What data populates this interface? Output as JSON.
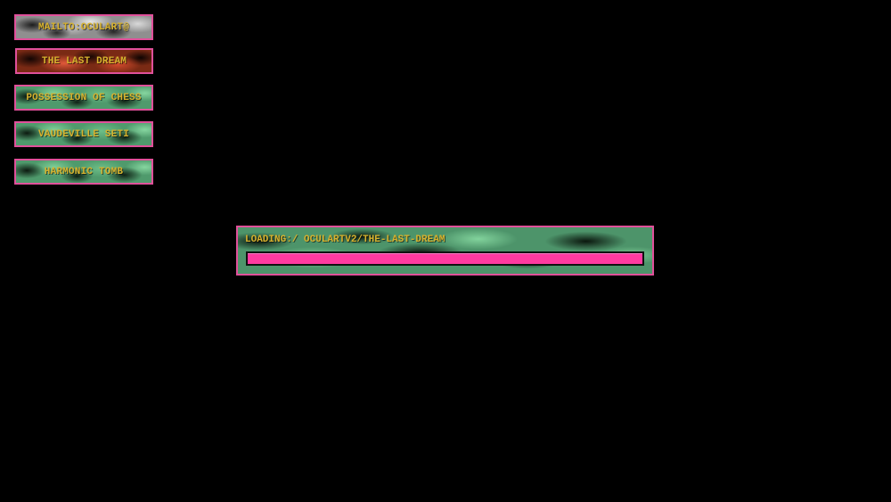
{
  "nav": {
    "items": [
      {
        "label": "MAILTO:OCULART@",
        "texture": "grey"
      },
      {
        "label": "THE LAST DREAM",
        "texture": "red"
      },
      {
        "label": "POSSESSION OF CHESS",
        "texture": "green"
      },
      {
        "label": "VAUDEVILLE SETI",
        "texture": "green"
      },
      {
        "label": "HARMONIC TOMB",
        "texture": "green"
      }
    ]
  },
  "loader": {
    "text": "LOADING:/ OCULARTV2/THE-LAST-DREAM",
    "progress": 1.0
  },
  "colors": {
    "background": "#000000",
    "border": "#e0509a",
    "label_text": "#d7b22e",
    "progress_fill": "#ff3aa0"
  }
}
